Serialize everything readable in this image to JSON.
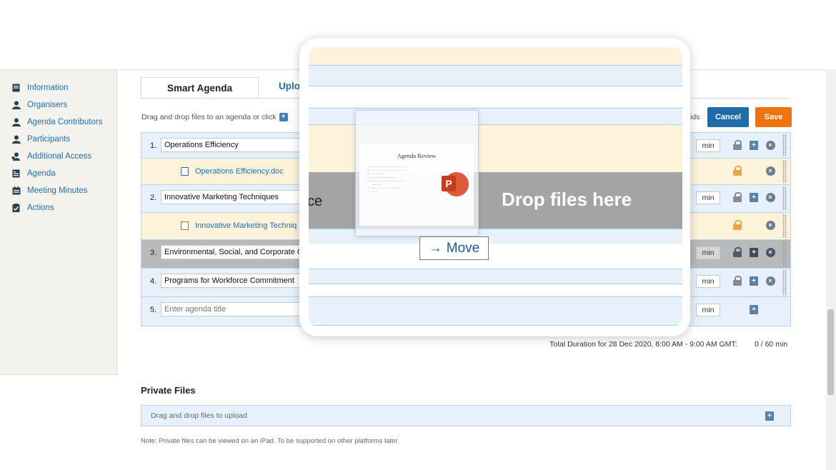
{
  "sidebar": {
    "items": [
      {
        "label": "Information",
        "icon": "document-icon"
      },
      {
        "label": "Organisers",
        "icon": "person-icon"
      },
      {
        "label": "Agenda Contributors",
        "icon": "person-icon"
      },
      {
        "label": "Participants",
        "icon": "person-icon"
      },
      {
        "label": "Additional Access",
        "icon": "person-key-icon"
      },
      {
        "label": "Agenda",
        "icon": "agenda-icon"
      },
      {
        "label": "Meeting Minutes",
        "icon": "calendar-icon"
      },
      {
        "label": "Actions",
        "icon": "clipboard-check-icon"
      }
    ]
  },
  "tabs": {
    "smart_agenda": "Smart Agenda",
    "upload": "Uplo"
  },
  "toolbar": {
    "hint": "Drag and drop files to an agenda or click",
    "ids": "ids",
    "cancel": "Cancel",
    "save": "Save"
  },
  "agenda": {
    "min_unit": "min",
    "items": [
      {
        "num": "1.",
        "title": "Operations Efficiency"
      },
      {
        "file": "Operations Efficiency.doc"
      },
      {
        "num": "2.",
        "title": "Innovative Marketing Techniques"
      },
      {
        "file": "Innovative Marketing Techniq"
      },
      {
        "num": "3.",
        "title": "Environmental, Social, and Corporate G"
      },
      {
        "num": "4.",
        "title": "Programs for Workforce Commitment"
      },
      {
        "num": "5.",
        "placeholder": "Enter agenda title"
      }
    ]
  },
  "total": {
    "label": "Total Duration for 28 Dec 2020, 8:00 AM - 9:00 AM GMT:",
    "value": "0 / 60 min"
  },
  "private_files": {
    "title": "Private Files",
    "drop_text": "Drag and drop files to upload",
    "note": "Note: Private files can be viewed on an iPad. To be supported on other platforms later."
  },
  "zoom": {
    "drop_text": "Drop files here",
    "partial_text": "ce",
    "doc_title": "Agenda Review",
    "ppt_letter": "P",
    "move_label": "Move",
    "move_arrow": "→"
  },
  "colors": {
    "link": "#1f6fb2",
    "cancel": "#1e6ca8",
    "save": "#f0720f",
    "row_blue": "#e6f1fb",
    "row_cream": "#fdf3da",
    "row_drag": "#b7babd"
  }
}
